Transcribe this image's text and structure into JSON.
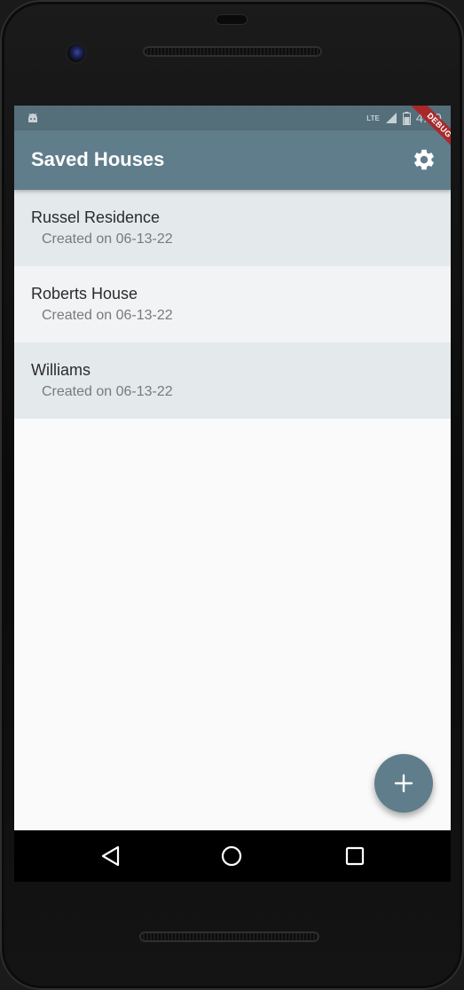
{
  "status_bar": {
    "network": "LTE",
    "time": "4:49"
  },
  "app_bar": {
    "title": "Saved Houses",
    "settings_icon": "gear-icon",
    "debug_banner": "DEBUG"
  },
  "houses": [
    {
      "name": "Russel Residence",
      "created": "Created on 06-13-22"
    },
    {
      "name": "Roberts House",
      "created": "Created on 06-13-22"
    },
    {
      "name": "Williams",
      "created": "Created on 06-13-22"
    }
  ],
  "fab": {
    "icon": "plus-icon"
  },
  "nav_bar": {
    "back_icon": "back-triangle-icon",
    "home_icon": "home-circle-icon",
    "recents_icon": "recents-square-icon"
  },
  "colors": {
    "primary": "#607d8b",
    "primary_dark": "#546e7a",
    "row_odd": "#e4e9ec",
    "row_even": "#f1f3f5",
    "debug": "#b71c1c"
  }
}
